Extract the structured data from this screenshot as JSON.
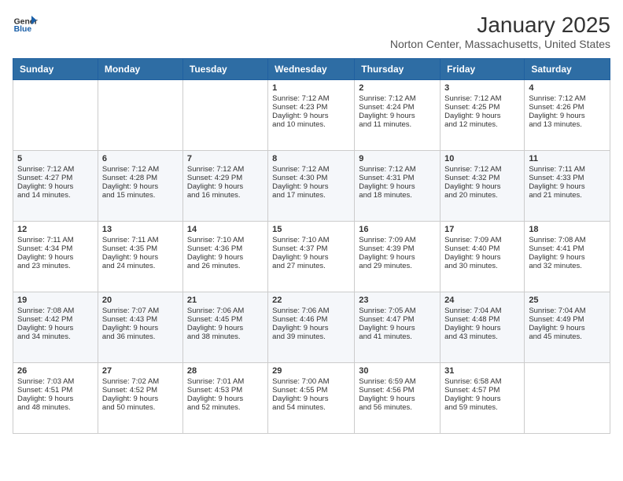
{
  "header": {
    "logo": {
      "general": "General",
      "blue": "Blue"
    },
    "title": "January 2025",
    "subtitle": "Norton Center, Massachusetts, United States"
  },
  "days_of_week": [
    "Sunday",
    "Monday",
    "Tuesday",
    "Wednesday",
    "Thursday",
    "Friday",
    "Saturday"
  ],
  "weeks": [
    [
      {
        "day": "",
        "info": ""
      },
      {
        "day": "",
        "info": ""
      },
      {
        "day": "",
        "info": ""
      },
      {
        "day": "1",
        "info": "Sunrise: 7:12 AM\nSunset: 4:23 PM\nDaylight: 9 hours\nand 10 minutes."
      },
      {
        "day": "2",
        "info": "Sunrise: 7:12 AM\nSunset: 4:24 PM\nDaylight: 9 hours\nand 11 minutes."
      },
      {
        "day": "3",
        "info": "Sunrise: 7:12 AM\nSunset: 4:25 PM\nDaylight: 9 hours\nand 12 minutes."
      },
      {
        "day": "4",
        "info": "Sunrise: 7:12 AM\nSunset: 4:26 PM\nDaylight: 9 hours\nand 13 minutes."
      }
    ],
    [
      {
        "day": "5",
        "info": "Sunrise: 7:12 AM\nSunset: 4:27 PM\nDaylight: 9 hours\nand 14 minutes."
      },
      {
        "day": "6",
        "info": "Sunrise: 7:12 AM\nSunset: 4:28 PM\nDaylight: 9 hours\nand 15 minutes."
      },
      {
        "day": "7",
        "info": "Sunrise: 7:12 AM\nSunset: 4:29 PM\nDaylight: 9 hours\nand 16 minutes."
      },
      {
        "day": "8",
        "info": "Sunrise: 7:12 AM\nSunset: 4:30 PM\nDaylight: 9 hours\nand 17 minutes."
      },
      {
        "day": "9",
        "info": "Sunrise: 7:12 AM\nSunset: 4:31 PM\nDaylight: 9 hours\nand 18 minutes."
      },
      {
        "day": "10",
        "info": "Sunrise: 7:12 AM\nSunset: 4:32 PM\nDaylight: 9 hours\nand 20 minutes."
      },
      {
        "day": "11",
        "info": "Sunrise: 7:11 AM\nSunset: 4:33 PM\nDaylight: 9 hours\nand 21 minutes."
      }
    ],
    [
      {
        "day": "12",
        "info": "Sunrise: 7:11 AM\nSunset: 4:34 PM\nDaylight: 9 hours\nand 23 minutes."
      },
      {
        "day": "13",
        "info": "Sunrise: 7:11 AM\nSunset: 4:35 PM\nDaylight: 9 hours\nand 24 minutes."
      },
      {
        "day": "14",
        "info": "Sunrise: 7:10 AM\nSunset: 4:36 PM\nDaylight: 9 hours\nand 26 minutes."
      },
      {
        "day": "15",
        "info": "Sunrise: 7:10 AM\nSunset: 4:37 PM\nDaylight: 9 hours\nand 27 minutes."
      },
      {
        "day": "16",
        "info": "Sunrise: 7:09 AM\nSunset: 4:39 PM\nDaylight: 9 hours\nand 29 minutes."
      },
      {
        "day": "17",
        "info": "Sunrise: 7:09 AM\nSunset: 4:40 PM\nDaylight: 9 hours\nand 30 minutes."
      },
      {
        "day": "18",
        "info": "Sunrise: 7:08 AM\nSunset: 4:41 PM\nDaylight: 9 hours\nand 32 minutes."
      }
    ],
    [
      {
        "day": "19",
        "info": "Sunrise: 7:08 AM\nSunset: 4:42 PM\nDaylight: 9 hours\nand 34 minutes."
      },
      {
        "day": "20",
        "info": "Sunrise: 7:07 AM\nSunset: 4:43 PM\nDaylight: 9 hours\nand 36 minutes."
      },
      {
        "day": "21",
        "info": "Sunrise: 7:06 AM\nSunset: 4:45 PM\nDaylight: 9 hours\nand 38 minutes."
      },
      {
        "day": "22",
        "info": "Sunrise: 7:06 AM\nSunset: 4:46 PM\nDaylight: 9 hours\nand 39 minutes."
      },
      {
        "day": "23",
        "info": "Sunrise: 7:05 AM\nSunset: 4:47 PM\nDaylight: 9 hours\nand 41 minutes."
      },
      {
        "day": "24",
        "info": "Sunrise: 7:04 AM\nSunset: 4:48 PM\nDaylight: 9 hours\nand 43 minutes."
      },
      {
        "day": "25",
        "info": "Sunrise: 7:04 AM\nSunset: 4:49 PM\nDaylight: 9 hours\nand 45 minutes."
      }
    ],
    [
      {
        "day": "26",
        "info": "Sunrise: 7:03 AM\nSunset: 4:51 PM\nDaylight: 9 hours\nand 48 minutes."
      },
      {
        "day": "27",
        "info": "Sunrise: 7:02 AM\nSunset: 4:52 PM\nDaylight: 9 hours\nand 50 minutes."
      },
      {
        "day": "28",
        "info": "Sunrise: 7:01 AM\nSunset: 4:53 PM\nDaylight: 9 hours\nand 52 minutes."
      },
      {
        "day": "29",
        "info": "Sunrise: 7:00 AM\nSunset: 4:55 PM\nDaylight: 9 hours\nand 54 minutes."
      },
      {
        "day": "30",
        "info": "Sunrise: 6:59 AM\nSunset: 4:56 PM\nDaylight: 9 hours\nand 56 minutes."
      },
      {
        "day": "31",
        "info": "Sunrise: 6:58 AM\nSunset: 4:57 PM\nDaylight: 9 hours\nand 59 minutes."
      },
      {
        "day": "",
        "info": ""
      }
    ]
  ]
}
